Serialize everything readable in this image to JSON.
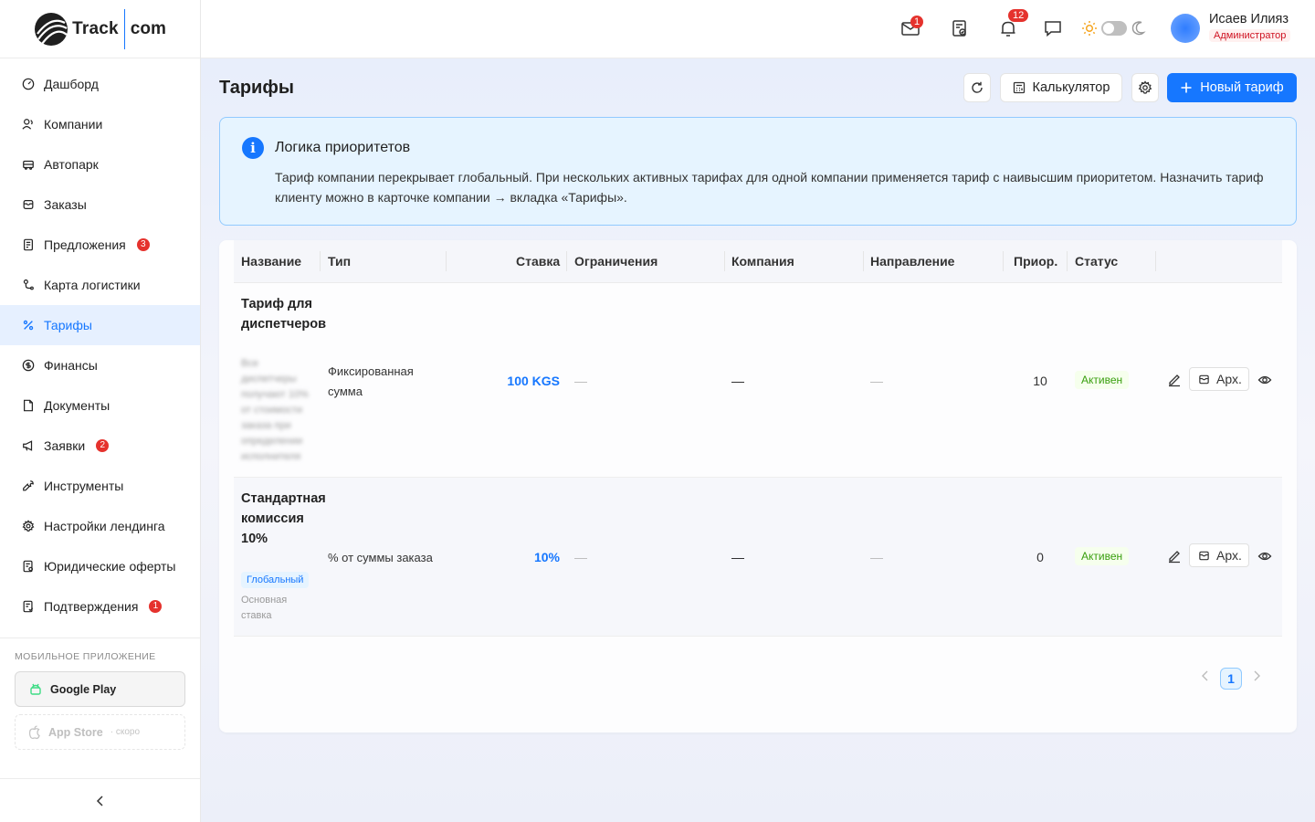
{
  "app": {
    "logo_text": "Track",
    "logo_suffix": "com"
  },
  "sidebar": {
    "items": [
      {
        "label": "Дашборд",
        "icon": "dashboard-icon"
      },
      {
        "label": "Компании",
        "icon": "companies-icon"
      },
      {
        "label": "Автопарк",
        "icon": "truck-icon"
      },
      {
        "label": "Заказы",
        "icon": "orders-icon"
      },
      {
        "label": "Предложения",
        "icon": "offers-icon",
        "badge": "3"
      },
      {
        "label": "Карта логистики",
        "icon": "map-icon"
      },
      {
        "label": "Тарифы",
        "icon": "percent-icon",
        "active": true
      },
      {
        "label": "Финансы",
        "icon": "dollar-icon"
      },
      {
        "label": "Документы",
        "icon": "document-icon"
      },
      {
        "label": "Заявки",
        "icon": "megaphone-icon",
        "badge": "2"
      },
      {
        "label": "Инструменты",
        "icon": "wrench-icon"
      },
      {
        "label": "Настройки лендинга",
        "icon": "gear-icon"
      },
      {
        "label": "Юридические оферты",
        "icon": "legal-icon"
      },
      {
        "label": "Подтверждения",
        "icon": "confirm-icon",
        "badge": "1"
      }
    ],
    "mobile_title": "МОБИЛЬНОЕ ПРИЛОЖЕНИЕ",
    "google_play": "Google Play",
    "app_store": "App Store",
    "app_store_note": "· скоро"
  },
  "header": {
    "mail_badge": "1",
    "bell_badge": "12",
    "user_name": "Исаев Илияз",
    "user_role": "Администратор"
  },
  "main": {
    "title": "Тарифы",
    "calc_label": "Калькулятор",
    "new_label": "Новый тариф",
    "info_title": "Логика приоритетов",
    "info_text": "Тариф компании перекрывает глобальный. При нескольких активных тарифах для одной компании применяется тариф с наивысшим приоритетом. Назначить тариф клиенту можно в карточке компании → вкладка «Тарифы»."
  },
  "table": {
    "headers": [
      "Название",
      "Тип",
      "Ставка",
      "Ограничения",
      "Компания",
      "Направление",
      "Приор.",
      "Статус"
    ],
    "rows": [
      {
        "name": "Тариф для диспетчеров",
        "desc": "Все диспетчеры получают 10% от стоимости заказа при определении исполнителя",
        "type": "Фиксированная сумма",
        "rate": "100 KGS",
        "limits": "—",
        "company": "—",
        "direction": "—",
        "priority": "10",
        "status": "Активен",
        "archive": "Арх."
      },
      {
        "name": "Стандартная комиссия 10%",
        "tag": "Глобальный",
        "desc": "Основная ставка",
        "type": "% от суммы заказа",
        "rate": "10%",
        "limits": "—",
        "company": "—",
        "direction": "—",
        "priority": "0",
        "status": "Активен",
        "archive": "Арх."
      }
    ],
    "page": "1"
  },
  "colors": {
    "accent": "#1677ff",
    "danger": "#e5322d",
    "success": "#389e0d"
  }
}
